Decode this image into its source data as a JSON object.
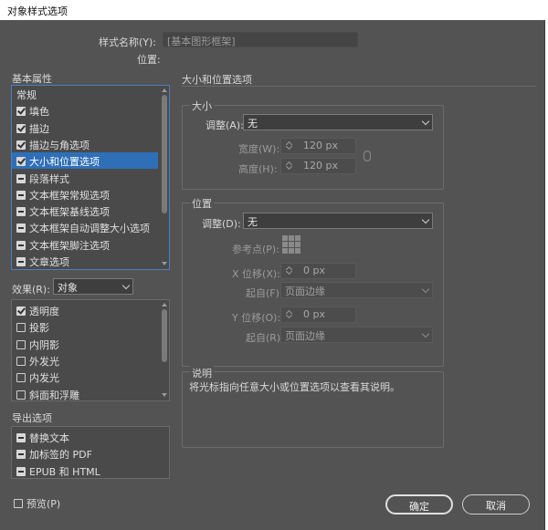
{
  "window": {
    "title": "对象样式选项"
  },
  "header": {
    "style_name_label": "样式名称(Y):",
    "style_name_value": "[基本图形框架]",
    "location_label": "位置:"
  },
  "basic_attributes": {
    "heading": "基本属性",
    "items": [
      {
        "label": "常规",
        "check": "none"
      },
      {
        "label": "填色",
        "check": "checked"
      },
      {
        "label": "描边",
        "check": "checked"
      },
      {
        "label": "描边与角选项",
        "check": "checked"
      },
      {
        "label": "大小和位置选项",
        "check": "checked",
        "selected": true
      },
      {
        "label": "段落样式",
        "check": "partial"
      },
      {
        "label": "文本框架常规选项",
        "check": "partial"
      },
      {
        "label": "文本框架基线选项",
        "check": "partial"
      },
      {
        "label": "文本框架自动调整大小选项",
        "check": "partial"
      },
      {
        "label": "文本框架脚注选项",
        "check": "partial"
      },
      {
        "label": "文章选项",
        "check": "partial"
      }
    ]
  },
  "effects": {
    "label": "效果(R):",
    "selected": "对象",
    "items": [
      {
        "label": "透明度",
        "check": "checked"
      },
      {
        "label": "投影",
        "check": "empty"
      },
      {
        "label": "内阴影",
        "check": "empty"
      },
      {
        "label": "外发光",
        "check": "empty"
      },
      {
        "label": "内发光",
        "check": "empty"
      },
      {
        "label": "斜面和浮雕",
        "check": "empty"
      }
    ]
  },
  "export": {
    "heading": "导出选项",
    "items": [
      {
        "label": "替换文本",
        "check": "partial"
      },
      {
        "label": "加标签的 PDF",
        "check": "partial"
      },
      {
        "label": "EPUB 和 HTML",
        "check": "partial"
      }
    ]
  },
  "preview": {
    "label": "预览(P)",
    "checked": false
  },
  "right": {
    "section_title": "大小和位置选项",
    "size": {
      "heading": "大小",
      "adjust_label": "调整(A):",
      "adjust_value": "无",
      "width_label": "宽度(W):",
      "width_value": "120 px",
      "height_label": "高度(H):",
      "height_value": "120 px"
    },
    "position": {
      "heading": "位置",
      "adjust_label": "调整(D):",
      "adjust_value": "无",
      "ref_point_label": "参考点(P):",
      "x_offset_label": "X 位移(X):",
      "x_offset_value": "0 px",
      "x_from_label": "起自(F):",
      "x_from_value": "页面边缘",
      "y_offset_label": "Y 位移(O):",
      "y_offset_value": "0 px",
      "y_from_label": "起自(R):",
      "y_from_value": "页面边缘"
    },
    "description": {
      "heading": "说明",
      "text": "将光标指向任意大小或位置选项以查看其说明。"
    }
  },
  "buttons": {
    "ok": "确定",
    "cancel": "取消"
  }
}
